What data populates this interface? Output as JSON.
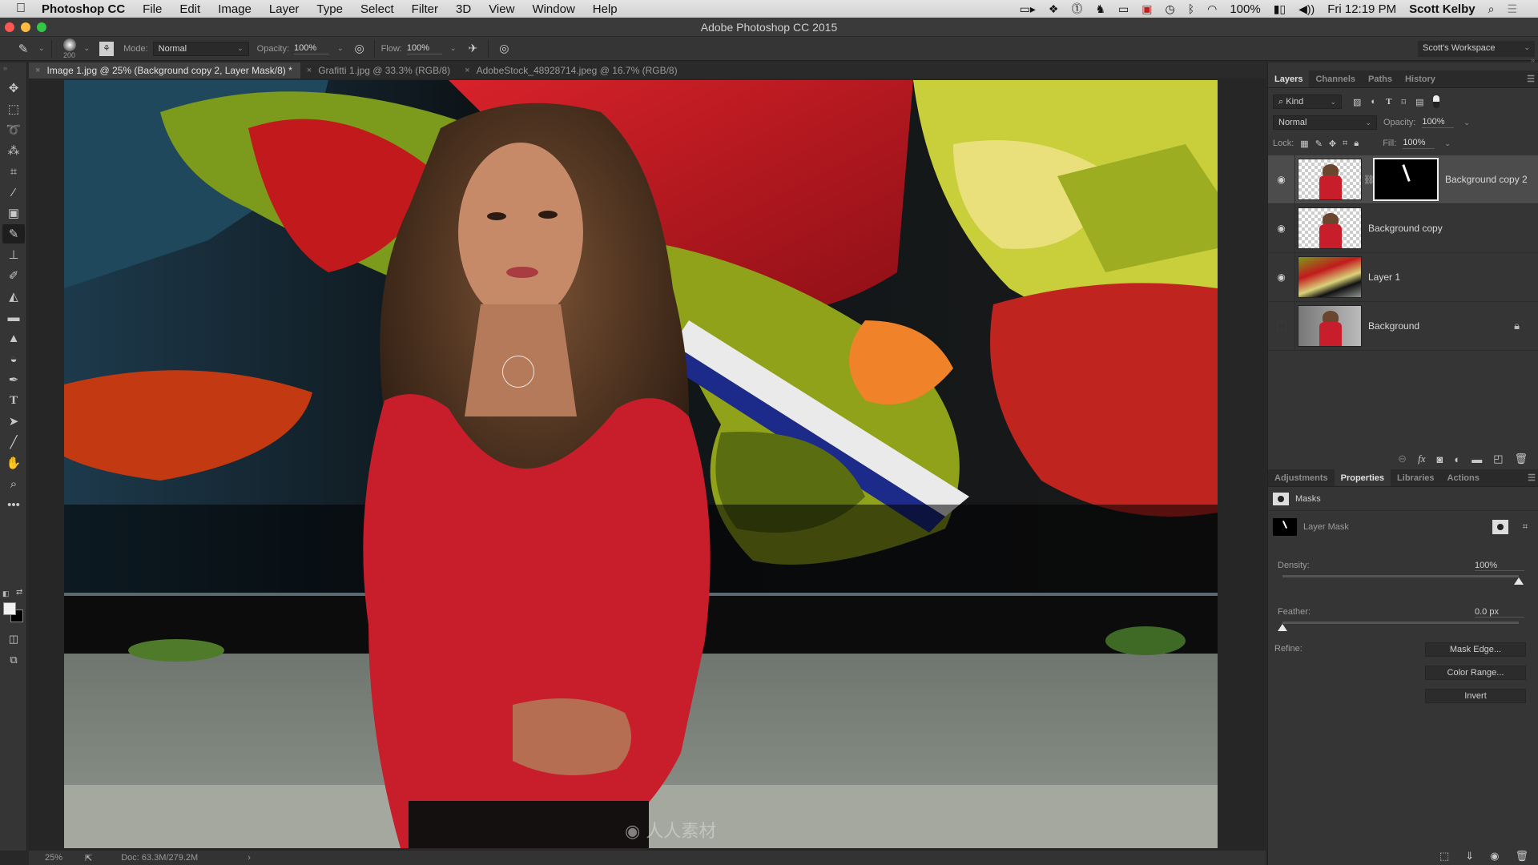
{
  "menubar": {
    "app_name": "Photoshop CC",
    "items": [
      "File",
      "Edit",
      "Image",
      "Layer",
      "Type",
      "Select",
      "Filter",
      "3D",
      "View",
      "Window",
      "Help"
    ],
    "status_icons": [
      "video-camera-icon",
      "dropbox-icon",
      "1password-icon",
      "evernote-icon",
      "airplay-icon",
      "display-icon",
      "time-machine-icon",
      "bluetooth-icon",
      "wifi-icon"
    ],
    "battery": "100%",
    "clock": "Fri 12:19 PM",
    "user": "Scott Kelby"
  },
  "window": {
    "title": "Adobe Photoshop CC 2015"
  },
  "options_bar": {
    "brush_size": "200",
    "mode_label": "Mode:",
    "mode_value": "Normal",
    "opacity_label": "Opacity:",
    "opacity_value": "100%",
    "flow_label": "Flow:",
    "flow_value": "100%",
    "workspace": "Scott's Workspace"
  },
  "tabs": [
    {
      "label": "Image 1.jpg @ 25% (Background copy 2, Layer Mask/8) *",
      "active": true
    },
    {
      "label": "Grafitti 1.jpg @ 33.3% (RGB/8)",
      "active": false
    },
    {
      "label": "AdobeStock_48928714.jpeg @ 16.7% (RGB/8)",
      "active": false
    }
  ],
  "tools": [
    "move",
    "marquee",
    "lasso",
    "quick-selection",
    "crop",
    "eyedropper",
    "healing-brush",
    "brush",
    "clone-stamp",
    "history-brush",
    "eraser",
    "gradient",
    "blur",
    "dodge",
    "pen",
    "type",
    "path-selection",
    "line",
    "hand",
    "zoom",
    "more"
  ],
  "colors": {
    "foreground": "#f2f2f2",
    "background": "#000000"
  },
  "status_bar": {
    "zoom": "25%",
    "doc_info": "Doc: 63.3M/279.2M"
  },
  "layers_panel": {
    "tabs": [
      "Layers",
      "Channels",
      "Paths",
      "History"
    ],
    "active_tab": "Layers",
    "filter_kind": "Kind",
    "blend_mode": "Normal",
    "opacity_label": "Opacity:",
    "opacity_value": "100%",
    "lock_label": "Lock:",
    "fill_label": "Fill:",
    "fill_value": "100%",
    "layers": [
      {
        "name": "Background copy 2",
        "visible": true,
        "selected": true,
        "has_mask": true,
        "locked": false
      },
      {
        "name": "Background copy",
        "visible": true,
        "selected": false,
        "has_mask": false,
        "locked": false
      },
      {
        "name": "Layer 1",
        "visible": true,
        "selected": false,
        "has_mask": false,
        "locked": false
      },
      {
        "name": "Background",
        "visible": false,
        "selected": false,
        "has_mask": false,
        "locked": true
      }
    ]
  },
  "properties_panel": {
    "tabs": [
      "Adjustments",
      "Properties",
      "Libraries",
      "Actions"
    ],
    "active_tab": "Properties",
    "section_title": "Masks",
    "mask_name": "Layer Mask",
    "density_label": "Density:",
    "density_value": "100%",
    "density_fraction": 1.0,
    "feather_label": "Feather:",
    "feather_value": "0.0 px",
    "feather_fraction": 0.0,
    "refine_label": "Refine:",
    "buttons": [
      "Mask Edge...",
      "Color Range...",
      "Invert"
    ]
  }
}
